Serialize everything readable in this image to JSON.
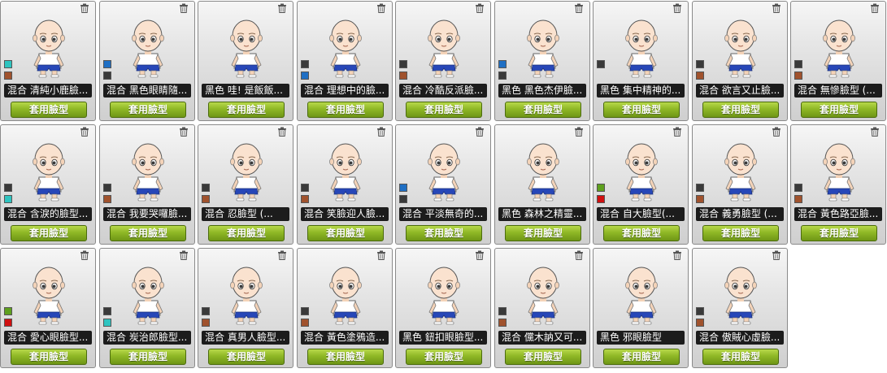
{
  "apply_label": "套用臉型",
  "faces": [
    {
      "name": "混合 清純小鹿臉...",
      "swatches": [
        "#2ec4c0",
        "#a0522d"
      ]
    },
    {
      "name": "混合 黑色眼睛隨...",
      "swatches": [
        "#1f6fc4",
        "#3a3a3a"
      ]
    },
    {
      "name": "黑色 哇! 是飯飯...",
      "swatches": []
    },
    {
      "name": "混合 理想中的臉...",
      "swatches": [
        "#3a3a3a",
        "#1f6fc4"
      ]
    },
    {
      "name": "混合 冷酷反派臉...",
      "swatches": [
        "#3a3a3a",
        "#a0522d"
      ]
    },
    {
      "name": "黑色 黑色杰伊臉...",
      "swatches": [
        "#1f6fc4",
        "#3a3a3a"
      ]
    },
    {
      "name": "黑色 集中精神的...",
      "swatches": [
        "#3a3a3a"
      ]
    },
    {
      "name": "混合 欲言又止臉...",
      "swatches": [
        "#3a3a3a",
        "#a0522d"
      ]
    },
    {
      "name": "混合 無慘臉型 (...",
      "swatches": [
        "#3a3a3a",
        "#a0522d"
      ]
    },
    {
      "name": "混合 含淚的臉型...",
      "swatches": [
        "#3a3a3a",
        "#2ec4c0"
      ]
    },
    {
      "name": "混合 我要哭囉臉...",
      "swatches": [
        "#3a3a3a",
        "#a0522d"
      ]
    },
    {
      "name": "混合 忍臉型 (...",
      "swatches": [
        "#3a3a3a",
        "#a0522d"
      ]
    },
    {
      "name": "混合 笑臉迎人臉...",
      "swatches": [
        "#3a3a3a",
        "#a0522d"
      ]
    },
    {
      "name": "混合 平淡無奇的...",
      "swatches": [
        "#1f6fc4",
        "#3a3a3a"
      ]
    },
    {
      "name": "黑色 森林之精靈...",
      "swatches": []
    },
    {
      "name": "混合 自大臉型(...",
      "swatches": [
        "#5ea01e",
        "#d01010"
      ]
    },
    {
      "name": "混合 義勇臉型 (...",
      "swatches": [
        "#3a3a3a",
        "#a0522d"
      ]
    },
    {
      "name": "混合 黃色路亞臉...",
      "swatches": [
        "#3a3a3a",
        "#a0522d"
      ]
    },
    {
      "name": "混合 愛心眼臉型...",
      "swatches": [
        "#5ea01e",
        "#d01010"
      ]
    },
    {
      "name": "混合 炭治郎臉型...",
      "swatches": [
        "#3a3a3a",
        "#2ec4c0"
      ]
    },
    {
      "name": "混合 真男人臉型...",
      "swatches": [
        "#3a3a3a",
        "#a0522d"
      ]
    },
    {
      "name": "混合 黃色塗鴉造...",
      "swatches": [
        "#3a3a3a",
        "#a0522d"
      ]
    },
    {
      "name": "黑色 鈕扣眼臉型...",
      "swatches": []
    },
    {
      "name": "混合 儻木訥又可...",
      "swatches": [
        "#3a3a3a",
        "#a0522d"
      ]
    },
    {
      "name": "黑色 邪眼臉型",
      "swatches": []
    },
    {
      "name": "混合 傲賊心虛臉...",
      "swatches": [
        "#3a3a3a",
        "#a0522d"
      ]
    }
  ]
}
